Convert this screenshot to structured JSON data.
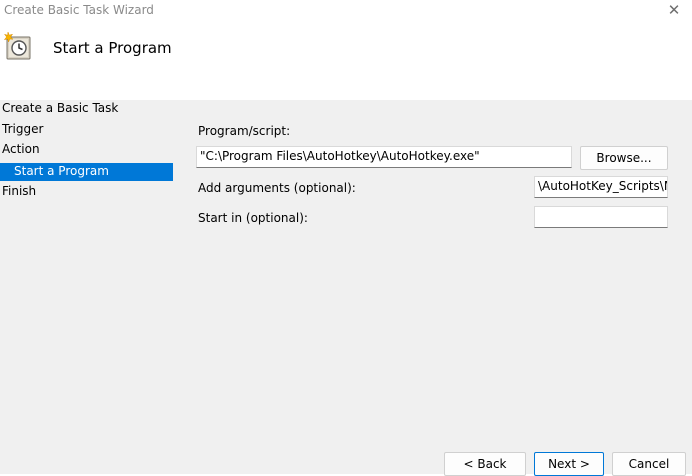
{
  "window": {
    "title": "Create Basic Task Wizard",
    "close_glyph": "✕"
  },
  "header": {
    "icon": "task-scheduler-clock-icon",
    "title": "Start a Program"
  },
  "steps": [
    {
      "label": "Create a Basic Task"
    },
    {
      "label": "Trigger"
    },
    {
      "label": "Action"
    },
    {
      "label": "Start a Program",
      "active": true
    },
    {
      "label": "Finish"
    }
  ],
  "form": {
    "program_label": "Program/script:",
    "program_value": "\"C:\\Program Files\\AutoHotkey\\AutoHotkey.exe\"",
    "browse_label": "Browse...",
    "arguments_label": "Add arguments (optional):",
    "arguments_value": "\\AutoHotKey_Scripts\\My",
    "start_in_label": "Start in (optional):",
    "start_in_value": ""
  },
  "buttons": {
    "back": "< Back",
    "next": "Next >",
    "cancel": "Cancel"
  },
  "colors": {
    "accent": "#0078d7",
    "panel": "#f0f0f0"
  }
}
